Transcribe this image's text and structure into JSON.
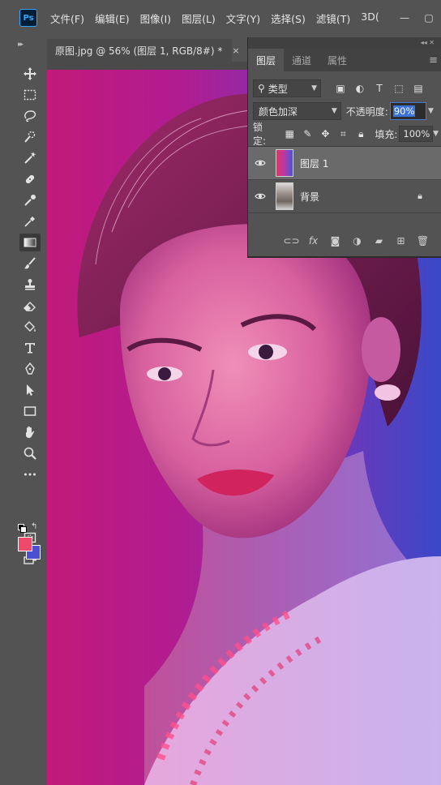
{
  "app": {
    "logo_text": "Ps"
  },
  "menu": [
    "文件(F)",
    "编辑(E)",
    "图像(I)",
    "图层(L)",
    "文字(Y)",
    "选择(S)",
    "滤镜(T)",
    "3D("
  ],
  "window_controls": {
    "minimize": "—",
    "maximize": "▢"
  },
  "document": {
    "tab_title": "原图.jpg @ 56% (图层 1, RGB/8#) *",
    "close": "×"
  },
  "tools": [
    "move-tool-icon",
    "marquee-tool-icon",
    "lasso-tool-icon",
    "quick-selection-tool-icon",
    "magic-wand-icon",
    "healing-brush-icon",
    "eyedropper-icon",
    "color-sampler-icon",
    "gradient-tool-icon",
    "brush-tool-icon",
    "clone-stamp-icon",
    "eraser-icon",
    "paint-bucket-icon",
    "type-tool-icon",
    "pen-tool-icon",
    "path-selection-icon",
    "rectangle-tool-icon",
    "hand-tool-icon",
    "zoom-tool-icon",
    "more-tools-icon",
    "quick-mask-icon",
    "screen-mode-icon"
  ],
  "colors": {
    "foreground": "#ee4a6a",
    "background": "#4a4fd4",
    "selection": "#3b73d9"
  },
  "layers_panel": {
    "tabs": [
      "图层",
      "通道",
      "属性"
    ],
    "active_tab": "图层",
    "filter_kind": "类型",
    "blend_mode": "颜色加深",
    "opacity_label": "不透明度:",
    "opacity_value": "90%",
    "lock_label": "锁定:",
    "fill_label": "填充:",
    "fill_value": "100%",
    "layers": [
      {
        "name": "图层 1",
        "selected": true,
        "visible": true,
        "locked": false,
        "thumb": "gradient"
      },
      {
        "name": "背景",
        "selected": false,
        "visible": true,
        "locked": true,
        "thumb": "photo"
      }
    ],
    "footer_icons": [
      "link-layers-icon",
      "fx-icon",
      "add-mask-icon",
      "adjustment-layer-icon",
      "new-group-icon",
      "new-layer-icon",
      "delete-layer-icon"
    ],
    "fx_label": "fx"
  }
}
